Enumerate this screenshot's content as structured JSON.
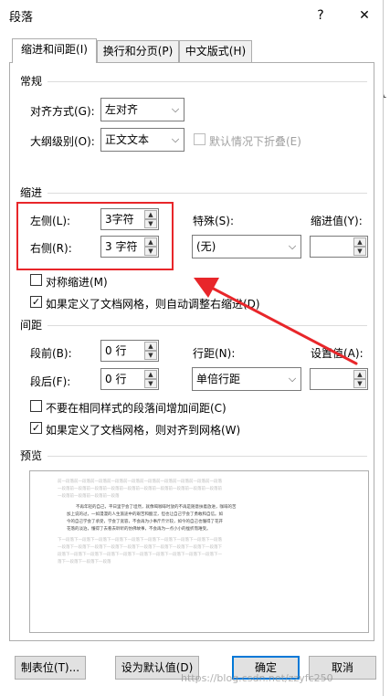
{
  "dialog": {
    "title": "段落",
    "help": "?",
    "close": "✕"
  },
  "tabs": [
    {
      "label": "缩进和间距(I)",
      "active": true
    },
    {
      "label": "换行和分页(P)",
      "active": false
    },
    {
      "label": "中文版式(H)",
      "active": false
    }
  ],
  "general": {
    "section": "常规",
    "alignment_label": "对齐方式(G):",
    "alignment_value": "左对齐",
    "outline_label": "大纲级别(O):",
    "outline_value": "正文文本",
    "collapse_label": "默认情况下折叠(E)"
  },
  "indent": {
    "section": "缩进",
    "left_label": "左侧(L):",
    "left_value": "3字符",
    "right_label": "右侧(R):",
    "right_value": "3 字符",
    "special_label": "特殊(S):",
    "special_value": "(无)",
    "indent_by_label": "缩进值(Y):",
    "indent_by_value": "",
    "mirror_label": "对称缩进(M)",
    "mirror_checked": false,
    "auto_adjust_label": "如果定义了文档网格，则自动调整右缩进(D)",
    "auto_adjust_checked": true
  },
  "spacing": {
    "section": "间距",
    "before_label": "段前(B):",
    "before_value": "0 行",
    "after_label": "段后(F):",
    "after_value": "0 行",
    "line_label": "行距(N):",
    "line_value": "单倍行距",
    "at_label": "设置值(A):",
    "at_value": "",
    "no_space_label": "不要在相同样式的段落间增加间距(C)",
    "no_space_checked": false,
    "snap_grid_label": "如果定义了文档网格，则对齐到网格(W)",
    "snap_grid_checked": true
  },
  "preview": {
    "section": "预览",
    "prev_lines": [
      "前一段落前一段落前一段落前一段落前一段落前一段落前一段落前一段落前一段落前一段落",
      "一段落前一段落前一段落前一段落前一段落前一段落前一段落前一段落前一段落前一段落前",
      "一段落前一段落前一段落前一段落"
    ],
    "main_lines": [
      "不再年轻的自己，平日里学会了坦然，就像喝咖啡时放的不再是随意扶着放进，咖啡的苦",
      "加上说的过，一如漫漫的人生旅途中的艰苦和酸涩，但也让自己学会了勇敢和自信。如",
      "今的自己学会了承受，学会了宽容，不会再为小事斤斤计较，如今的自己也懂得了花开",
      "花落的淡泊，懂得了去看去聆听的仿佛故事，不会再为一点小小的挫折而难受。"
    ],
    "next_lines": [
      "下一段落下一段落下一段落下一段落下一段落下一段落下一段落下一段落下一段落下一段落",
      "一段落下一段落下一段落下一段落下一段落下一段落下一段落下一段落下一段落下一段落下",
      "段落下一段落下一段落下一段落下一段落下一段落下一段落下一段落下一段落下一段落下一",
      "落下一段落下一段落下一段落"
    ]
  },
  "buttons": {
    "tabs": "制表位(T)...",
    "set_default": "设为默认值(D)",
    "ok": "确定",
    "cancel": "取消"
  },
  "watermark": "https://blog.csdn.net/zzyfc250",
  "accent_colors": {
    "highlight_box": "#e8262a",
    "arrow": "#e8262a",
    "primary_button": "#0078d7"
  }
}
